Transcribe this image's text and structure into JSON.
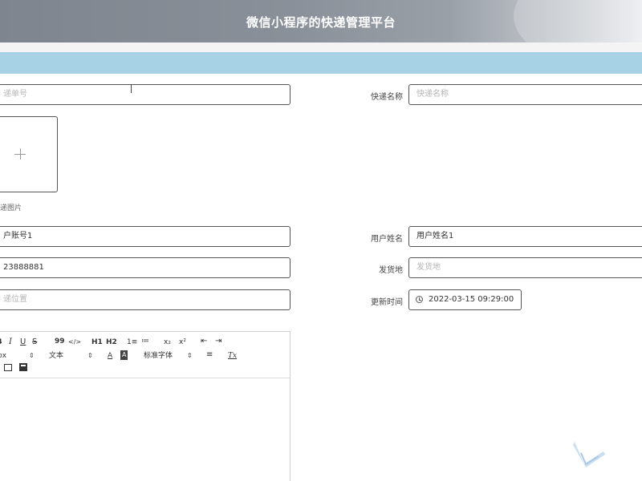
{
  "header": {
    "title": "微信小程序的快递管理平台"
  },
  "form": {
    "tracking_no": {
      "placeholder": "递单号"
    },
    "express_name": {
      "label": "快递名称",
      "placeholder": "快递名称"
    },
    "image": {
      "caption": "递图片"
    },
    "user_account": {
      "value": "户账号1"
    },
    "user_name": {
      "label": "用户姓名",
      "value": "用户姓名1"
    },
    "phone": {
      "value": "23888881"
    },
    "shipper": {
      "label": "发货地",
      "placeholder": "发货地"
    },
    "location": {
      "placeholder": "递位置"
    },
    "update_time": {
      "label": "更新时间",
      "value": "2022-03-15 09:29:00"
    }
  },
  "editor": {
    "toolbar": {
      "bold": "B",
      "italic": "I",
      "underline": "U",
      "strike": "S",
      "quote": "99",
      "code": "</>",
      "h1": "H1",
      "h2": "H2",
      "ordered_list": "1≡",
      "bullet_list": "≔",
      "subscript": "x₂",
      "superscript": "x²",
      "indent_dec": "⇤",
      "indent_inc": "⇥",
      "size_select": "px",
      "text_select": "文本",
      "font_color": "A",
      "bg_color": "A",
      "font_family_select": "标准字体",
      "align": "≡",
      "clear_format": "Tx"
    }
  }
}
